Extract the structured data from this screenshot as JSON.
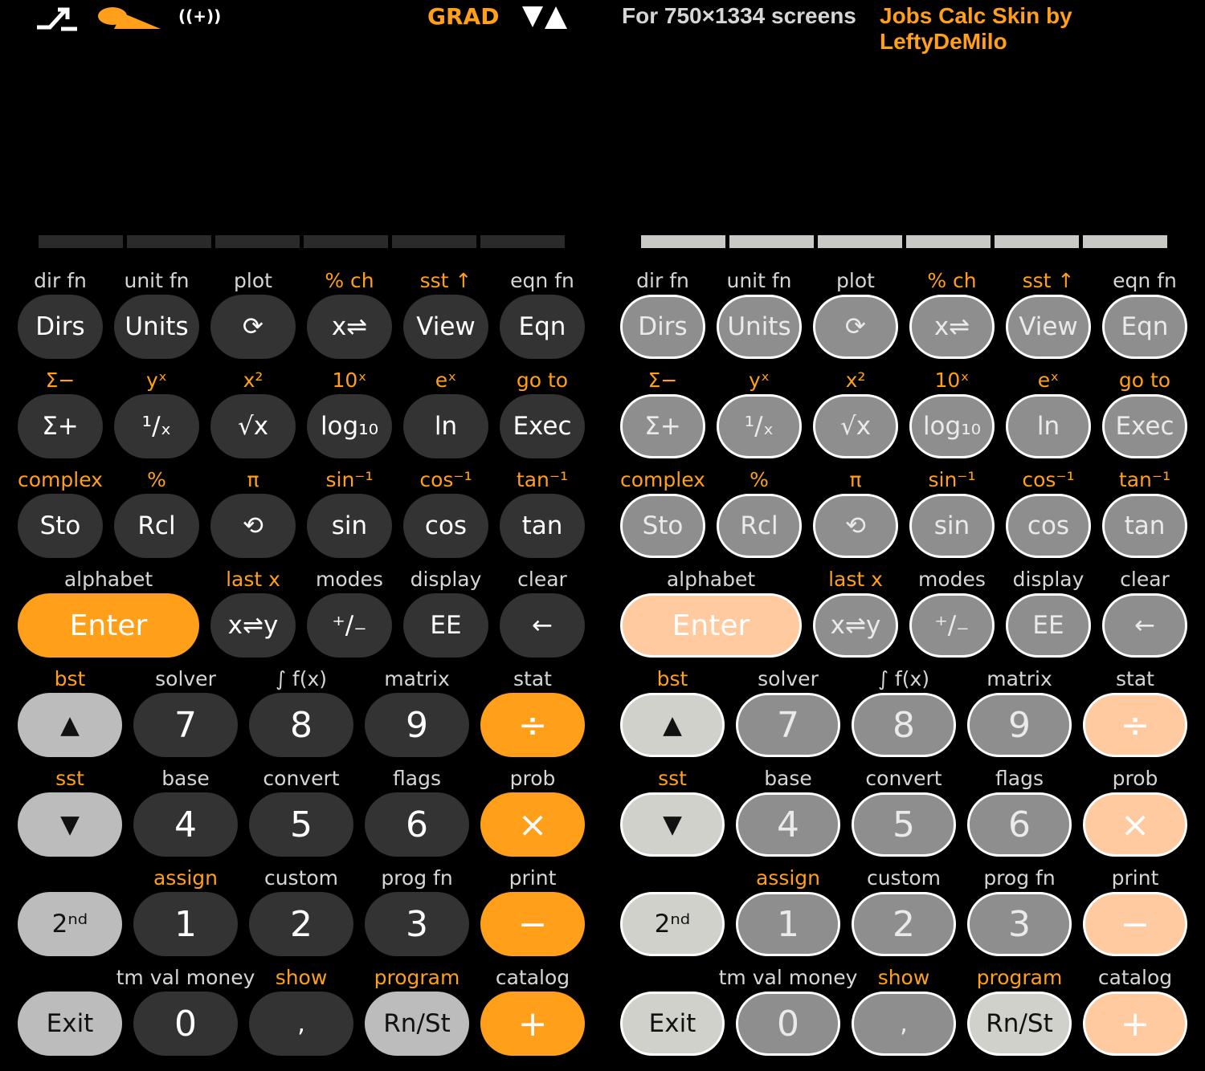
{
  "status": {
    "icons": [
      "shift-arrow-icon",
      "key-icon",
      "beep-icon"
    ],
    "beep_text": "((+))",
    "angle_mode": "GRAD",
    "slope_icon": "triangle-icon"
  },
  "header": {
    "screens_text": "For 750×1334 screens",
    "credit_text": "Jobs Calc Skin by LeftyDeMilo"
  },
  "colors": {
    "accent": "#ff9f1a",
    "key_dark": "#333333",
    "key_light": "#bcbcbc",
    "background": "#000000"
  },
  "rows": [
    {
      "labels": [
        {
          "text": "dir fn",
          "orange": false
        },
        {
          "text": "unit fn",
          "orange": false
        },
        {
          "text": "plot",
          "orange": false
        },
        {
          "text": "% ch",
          "orange": true
        },
        {
          "text": "sst ↑",
          "orange": true
        },
        {
          "text": "eqn fn",
          "orange": false
        }
      ],
      "keys": [
        {
          "name": "dirs",
          "text": "Dirs",
          "style": "dark"
        },
        {
          "name": "units",
          "text": "Units",
          "style": "dark"
        },
        {
          "name": "rotate",
          "text": "⟳",
          "style": "dark",
          "icon": "rotate-icon"
        },
        {
          "name": "x-swap",
          "text": "x⇌",
          "style": "dark"
        },
        {
          "name": "view",
          "text": "View",
          "style": "dark"
        },
        {
          "name": "eqn",
          "text": "Eqn",
          "style": "dark"
        }
      ]
    },
    {
      "labels": [
        {
          "text": "Σ−",
          "orange": true
        },
        {
          "text": "yˣ",
          "orange": true
        },
        {
          "text": "x²",
          "orange": true
        },
        {
          "text": "10ˣ",
          "orange": true
        },
        {
          "text": "eˣ",
          "orange": true
        },
        {
          "text": "go to",
          "orange": true
        }
      ],
      "keys": [
        {
          "name": "sigma-plus",
          "text": "Σ+",
          "style": "dark"
        },
        {
          "name": "reciprocal",
          "text": "¹/ₓ",
          "style": "dark"
        },
        {
          "name": "sqrt",
          "text": "√x",
          "style": "dark"
        },
        {
          "name": "log10",
          "text": "log₁₀",
          "style": "dark"
        },
        {
          "name": "ln",
          "text": "ln",
          "style": "dark"
        },
        {
          "name": "exec",
          "text": "Exec",
          "style": "dark"
        }
      ]
    },
    {
      "labels": [
        {
          "text": "complex",
          "orange": true
        },
        {
          "text": "%",
          "orange": true
        },
        {
          "text": "π",
          "orange": true
        },
        {
          "text": "sin⁻¹",
          "orange": true
        },
        {
          "text": "cos⁻¹",
          "orange": true
        },
        {
          "text": "tan⁻¹",
          "orange": true
        }
      ],
      "keys": [
        {
          "name": "sto",
          "text": "Sto",
          "style": "dark"
        },
        {
          "name": "rcl",
          "text": "Rcl",
          "style": "dark"
        },
        {
          "name": "rotate2",
          "text": "⟲",
          "style": "dark",
          "icon": "rotate-icon"
        },
        {
          "name": "sin",
          "text": "sin",
          "style": "dark"
        },
        {
          "name": "cos",
          "text": "cos",
          "style": "dark"
        },
        {
          "name": "tan",
          "text": "tan",
          "style": "dark"
        }
      ]
    }
  ],
  "row4": {
    "labels": [
      {
        "text": "alphabet",
        "orange": false
      },
      {
        "text": "last x",
        "orange": true
      },
      {
        "text": "modes",
        "orange": false
      },
      {
        "text": "display",
        "orange": false
      },
      {
        "text": "clear",
        "orange": false
      }
    ],
    "keys": [
      {
        "name": "enter",
        "text": "Enter",
        "style": "org"
      },
      {
        "name": "x-swap-y",
        "text": "x⇌y",
        "style": "dark"
      },
      {
        "name": "plus-minus",
        "text": "⁺/₋",
        "style": "dark"
      },
      {
        "name": "ee",
        "text": "EE",
        "style": "dark"
      },
      {
        "name": "backspace",
        "text": "←",
        "style": "dark",
        "icon": "backspace-arrow-icon"
      }
    ]
  },
  "numrows": [
    {
      "labels": [
        {
          "text": "bst",
          "orange": true
        },
        {
          "text": "solver",
          "orange": false
        },
        {
          "text": "∫ f(x)",
          "orange": false
        },
        {
          "text": "matrix",
          "orange": false
        },
        {
          "text": "stat",
          "orange": false
        }
      ],
      "keys": [
        {
          "name": "up",
          "text": "▲",
          "style": "lgrey",
          "icon": "up-triangle-icon"
        },
        {
          "name": "digit-7",
          "text": "7",
          "style": "dark"
        },
        {
          "name": "digit-8",
          "text": "8",
          "style": "dark"
        },
        {
          "name": "digit-9",
          "text": "9",
          "style": "dark"
        },
        {
          "name": "divide",
          "text": "÷",
          "style": "org"
        }
      ]
    },
    {
      "labels": [
        {
          "text": "sst",
          "orange": true
        },
        {
          "text": "base",
          "orange": false
        },
        {
          "text": "convert",
          "orange": false
        },
        {
          "text": "flags",
          "orange": false
        },
        {
          "text": "prob",
          "orange": false
        }
      ],
      "keys": [
        {
          "name": "down",
          "text": "▼",
          "style": "lgrey",
          "icon": "down-triangle-icon"
        },
        {
          "name": "digit-4",
          "text": "4",
          "style": "dark"
        },
        {
          "name": "digit-5",
          "text": "5",
          "style": "dark"
        },
        {
          "name": "digit-6",
          "text": "6",
          "style": "dark"
        },
        {
          "name": "multiply",
          "text": "×",
          "style": "org"
        }
      ]
    },
    {
      "labels": [
        {
          "text": "",
          "orange": false
        },
        {
          "text": "assign",
          "orange": true
        },
        {
          "text": "custom",
          "orange": false
        },
        {
          "text": "prog fn",
          "orange": false
        },
        {
          "text": "print",
          "orange": false
        }
      ],
      "keys": [
        {
          "name": "second",
          "text": "2ⁿᵈ",
          "style": "lgrey"
        },
        {
          "name": "digit-1",
          "text": "1",
          "style": "dark"
        },
        {
          "name": "digit-2",
          "text": "2",
          "style": "dark"
        },
        {
          "name": "digit-3",
          "text": "3",
          "style": "dark"
        },
        {
          "name": "minus",
          "text": "−",
          "style": "org"
        }
      ]
    },
    {
      "labels": [
        {
          "text": "",
          "orange": false
        },
        {
          "text": "tm val money",
          "orange": false
        },
        {
          "text": "show",
          "orange": true
        },
        {
          "text": "program",
          "orange": true
        },
        {
          "text": "catalog",
          "orange": false
        }
      ],
      "keys": [
        {
          "name": "exit",
          "text": "Exit",
          "style": "lgrey"
        },
        {
          "name": "digit-0",
          "text": "0",
          "style": "dark"
        },
        {
          "name": "comma",
          "text": ",",
          "style": "dark"
        },
        {
          "name": "run-stop",
          "text": "Rn/St",
          "style": "lgrey"
        },
        {
          "name": "plus",
          "text": "+",
          "style": "org"
        }
      ]
    }
  ]
}
